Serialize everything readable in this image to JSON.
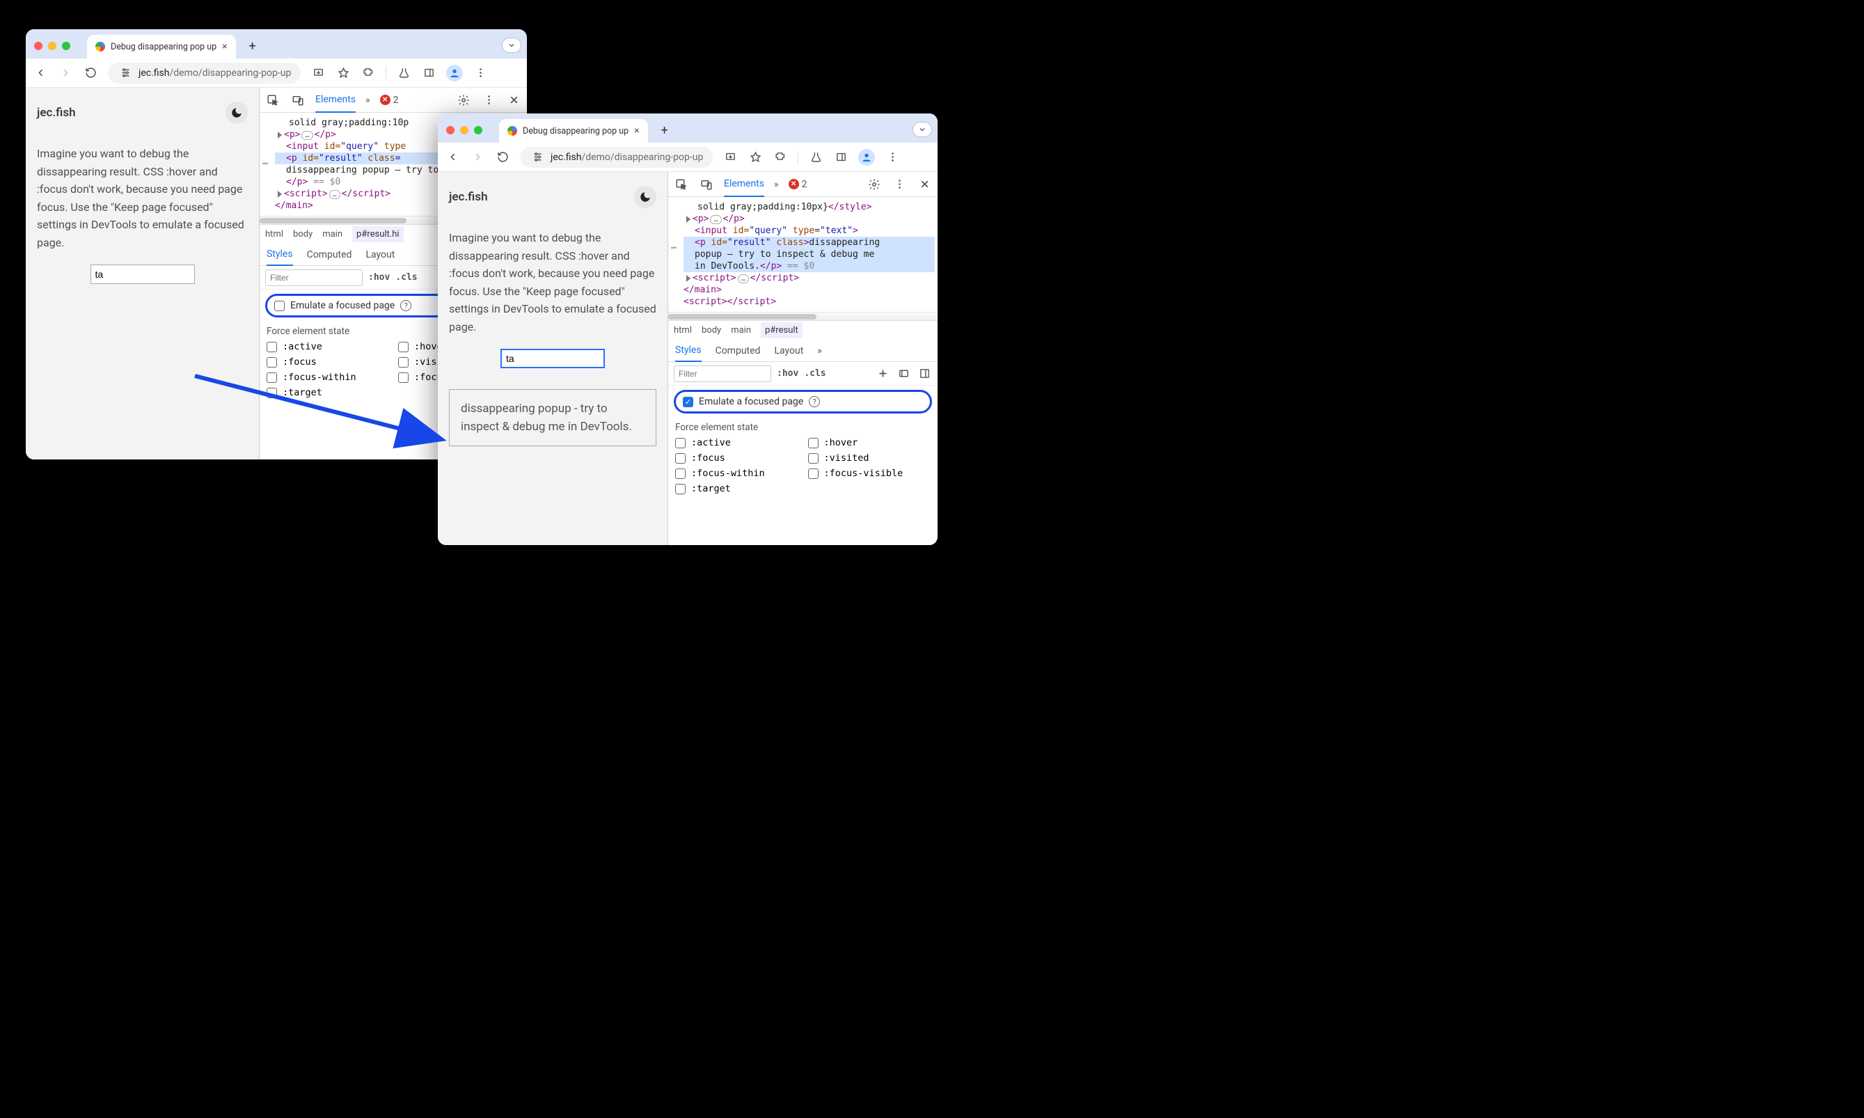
{
  "shared": {
    "tab_title": "Debug disappearing pop up",
    "url_host": "jec.fish",
    "url_path": "/demo/disappearing-pop-up",
    "site_title": "jec.fish",
    "page_text": "Imagine you want to debug the dissappearing result. CSS :hover and :focus don't work, because you need page focus. Use the \"Keep page focused\" settings in DevTools to emulate a focused page.",
    "query_value": "ta",
    "popup_text": "dissappearing popup - try to inspect & debug me in DevTools.",
    "elements_tab": "Elements",
    "errors_count": "2",
    "styles_tab": "Styles",
    "computed_tab": "Computed",
    "layout_tab": "Layout",
    "filter_placeholder": "Filter",
    "hov_label": ":hov",
    "cls_label": ".cls",
    "emulate_label": "Emulate a focused page",
    "force_state_label": "Force element state",
    "states": {
      "active": ":active",
      "hover": ":hover",
      "focus": ":focus",
      "visited": ":visited",
      "focus_within": ":focus-within",
      "focus_visible": ":focus-visible",
      "target": ":target"
    },
    "crumbs": {
      "html": "html",
      "body": "body",
      "main": "main"
    },
    "dom_style_line": "solid gray;padding:10p",
    "dom_style_line2": "solid gray;padding:10px}",
    "dom_p": "<p>",
    "dom_p_close": "</p>",
    "dom_input_pre": "<input ",
    "dom_input_id": "id=",
    "dom_input_idv": "\"query\"",
    "dom_input_type": "type",
    "dom_input_typev": "\"text\"",
    "dom_result_pre": "<p ",
    "dom_result_idv": "\"result\"",
    "dom_result_class": "class",
    "dom_result_text_short": "dissappearing popup – try to inspect & debug me in",
    "dom_result_text_full": "dissappearing popup – try to inspect & debug me in DevTools.",
    "dom_eq": " == ",
    "dom_dollar": "$0",
    "dom_script": "<script>",
    "dom_script_close": "</script>",
    "dom_main_close": "</main>",
    "dom_style_close": "</style>"
  },
  "win1": {
    "crumb_current": "p#result.hi",
    "states_right": {
      "hover": ":hove",
      "visited": ":visi",
      "focus_visible": ":focu"
    },
    "emulate_checked": false,
    "dom_input_type_trunc": "type"
  },
  "win2": {
    "crumb_current": "p#result",
    "emulate_checked": true
  }
}
